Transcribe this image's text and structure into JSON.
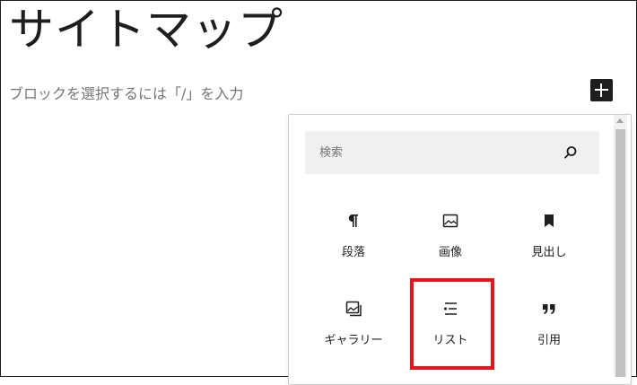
{
  "editor": {
    "page_title": "サイトマップ",
    "block_placeholder": "ブロックを選択するには「/」を入力",
    "add_block_label": "+"
  },
  "inserter": {
    "search": {
      "placeholder": "検索",
      "value": ""
    },
    "blocks": [
      {
        "label": "段落",
        "icon": "paragraph-icon"
      },
      {
        "label": "画像",
        "icon": "image-icon"
      },
      {
        "label": "見出し",
        "icon": "heading-bookmark-icon"
      },
      {
        "label": "ギャラリー",
        "icon": "gallery-icon"
      },
      {
        "label": "リスト",
        "icon": "list-icon"
      },
      {
        "label": "引用",
        "icon": "quote-icon"
      }
    ]
  },
  "annotation": {
    "highlighted_block": "リスト",
    "highlight_color": "#e8141b"
  },
  "colors": {
    "text": "#1e1e1e",
    "placeholder": "#757575",
    "search_bg": "#f0f0f0"
  }
}
